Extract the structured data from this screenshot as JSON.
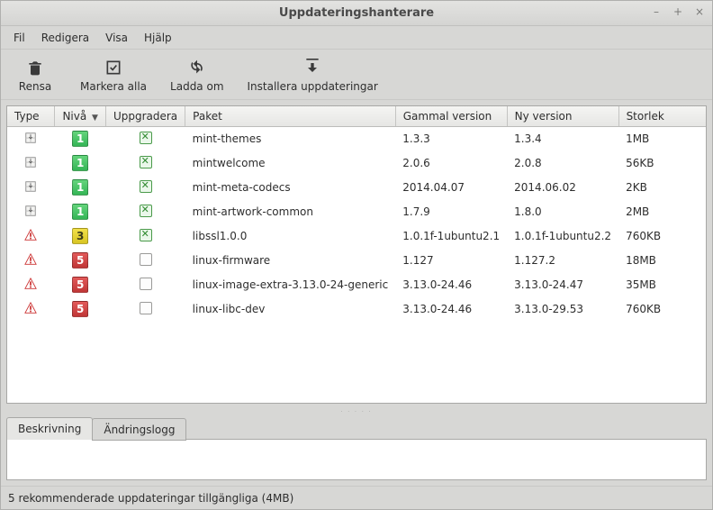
{
  "window": {
    "title": "Uppdateringshanterare"
  },
  "wincontrols": {
    "min": "–",
    "max": "+",
    "close": "×"
  },
  "menu": {
    "file": "Fil",
    "edit": "Redigera",
    "view": "Visa",
    "help": "Hjälp"
  },
  "toolbar": {
    "clear": {
      "label": "Rensa"
    },
    "selectall": {
      "label": "Markera alla"
    },
    "reload": {
      "label": "Ladda om"
    },
    "install": {
      "label": "Installera uppdateringar"
    }
  },
  "columns": {
    "type": "Type",
    "level": "Nivå",
    "upgrade": "Uppgradera",
    "package": "Paket",
    "old": "Gammal version",
    "new": "Ny version",
    "size": "Storlek",
    "sort_indicator": "▼"
  },
  "rows": [
    {
      "type": "package",
      "level": 1,
      "checked": true,
      "package": "mint-themes",
      "old": "1.3.3",
      "new": "1.3.4",
      "size": "1MB"
    },
    {
      "type": "package",
      "level": 1,
      "checked": true,
      "package": "mintwelcome",
      "old": "2.0.6",
      "new": "2.0.8",
      "size": "56KB"
    },
    {
      "type": "package",
      "level": 1,
      "checked": true,
      "package": "mint-meta-codecs",
      "old": "2014.04.07",
      "new": "2014.06.02",
      "size": "2KB"
    },
    {
      "type": "package",
      "level": 1,
      "checked": true,
      "package": "mint-artwork-common",
      "old": "1.7.9",
      "new": "1.8.0",
      "size": "2MB"
    },
    {
      "type": "security",
      "level": 3,
      "checked": true,
      "package": "libssl1.0.0",
      "old": "1.0.1f-1ubuntu2.1",
      "new": "1.0.1f-1ubuntu2.2",
      "size": "760KB"
    },
    {
      "type": "security",
      "level": 5,
      "checked": false,
      "package": "linux-firmware",
      "old": "1.127",
      "new": "1.127.2",
      "size": "18MB"
    },
    {
      "type": "security",
      "level": 5,
      "checked": false,
      "package": "linux-image-extra-3.13.0-24-generic",
      "old": "3.13.0-24.46",
      "new": "3.13.0-24.47",
      "size": "35MB"
    },
    {
      "type": "security",
      "level": 5,
      "checked": false,
      "package": "linux-libc-dev",
      "old": "3.13.0-24.46",
      "new": "3.13.0-29.53",
      "size": "760KB"
    }
  ],
  "tabs": {
    "description": "Beskrivning",
    "changelog": "Ändringslogg"
  },
  "status": "5 rekommenderade uppdateringar tillgängliga (4MB)"
}
